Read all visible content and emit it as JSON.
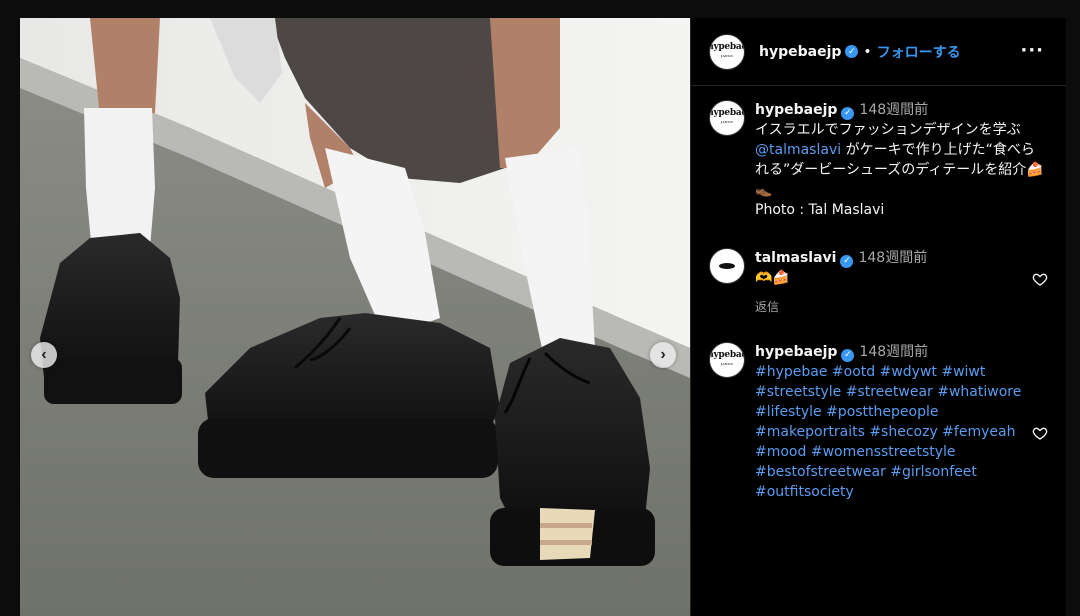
{
  "post": {
    "author": "hypebaejp",
    "avatar_text": "hypebae",
    "avatar_subtext": "JAPAN",
    "separator": "•",
    "follow_label": "フォローする",
    "more_label": "···"
  },
  "caption": {
    "username": "hypebaejp",
    "time": "148週間前",
    "text_part1": "イスラエルでファッションデザインを学ぶ",
    "mention": "@talmaslavi",
    "text_part2": "がケーキで作り上げた“食べられる”ダービーシューズのディテールを紹介🍰👞",
    "photo_credit": "Photo : Tal Maslavi"
  },
  "comments": [
    {
      "username": "talmaslavi",
      "time": "148週間前",
      "text": "🫶🍰",
      "reply_label": "返信"
    },
    {
      "username": "hypebaejp",
      "time": "148週間前",
      "hashtags": "#hypebae #ootd #wdywt #wiwt #streetstyle #streetwear #whatiwore #lifestyle #postthepeople #makeportraits #shecozy #femyeah #mood #womensstreetstyle #bestofstreetwear #girlsonfeet #outfitsociety"
    }
  ],
  "icons": {
    "verified": "verified-badge-icon",
    "heart": "heart-outline-icon",
    "prev": "chevron-left-icon",
    "next": "chevron-right-icon"
  },
  "colors": {
    "accent": "#3897f0",
    "link": "#5a9cf0",
    "muted": "#a8a8a8",
    "background": "#000000"
  }
}
